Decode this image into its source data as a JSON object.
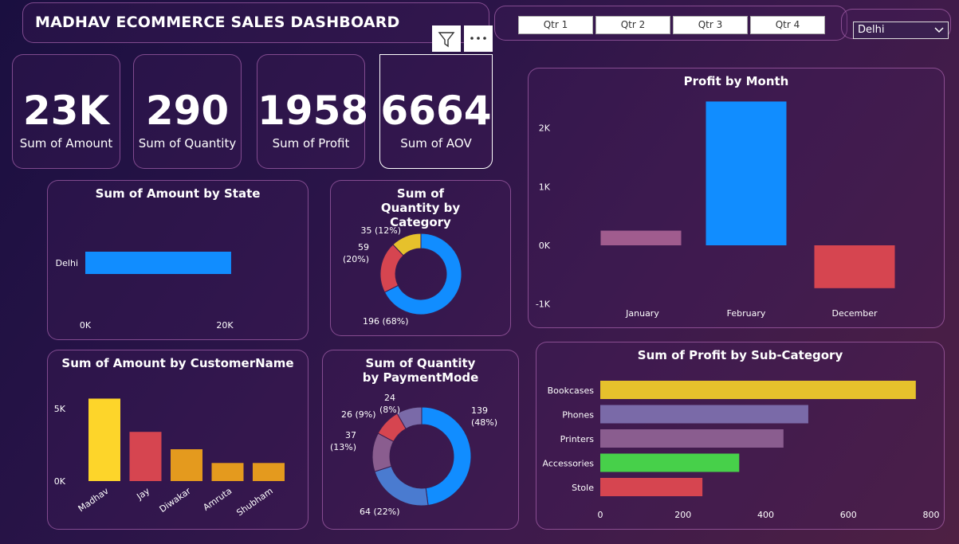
{
  "header": {
    "title": "MADHAV ECOMMERCE SALES DASHBOARD"
  },
  "slicer": {
    "quarters": [
      "Qtr 1",
      "Qtr 2",
      "Qtr 3",
      "Qtr 4"
    ],
    "state_selected": "Delhi"
  },
  "kpis": [
    {
      "value": "23K",
      "label": "Sum of Amount"
    },
    {
      "value": "290",
      "label": "Sum of Quantity"
    },
    {
      "value": "1958",
      "label": "Sum of Profit"
    },
    {
      "value": "6664",
      "label": "Sum of AOV"
    }
  ],
  "chart_data": [
    {
      "id": "amount_by_state",
      "type": "bar",
      "orientation": "horizontal",
      "title": "Sum of Amount by State",
      "categories": [
        "Delhi"
      ],
      "values": [
        23000
      ],
      "xlim": [
        0,
        22000
      ],
      "xticks": [
        "0K",
        "20K"
      ],
      "color": "#118dff"
    },
    {
      "id": "qty_by_category",
      "type": "pie",
      "donut": true,
      "title": "Sum of Quantity by Category",
      "values": [
        196,
        59,
        35
      ],
      "labels": [
        "196 (68%)",
        "59 (20%)",
        "35 (12%)"
      ],
      "colors": [
        "#118dff",
        "#d64550",
        "#e6c12c"
      ]
    },
    {
      "id": "amount_by_customer",
      "type": "bar",
      "title": "Sum of Amount by CustomerName",
      "categories": [
        "Madhav",
        "Jay",
        "Diwakar",
        "Amruta",
        "Shubham"
      ],
      "values": [
        5700,
        3400,
        2200,
        1250,
        1250
      ],
      "ylim": [
        0,
        6000
      ],
      "yticks": [
        "0K",
        "5K"
      ],
      "colors": [
        "#fdd52a",
        "#d64550",
        "#e49a1e",
        "#e49a1e",
        "#e49a1e"
      ]
    },
    {
      "id": "qty_by_payment",
      "type": "pie",
      "donut": true,
      "title": "Sum of Quantity by PaymentMode",
      "values": [
        139,
        64,
        37,
        26,
        24
      ],
      "labels": [
        "139 (48%)",
        "64 (22%)",
        "37 (13%)",
        "26 (9%)",
        "24 (8%)"
      ],
      "colors": [
        "#118dff",
        "#4a7bd0",
        "#8a5d8f",
        "#d64550",
        "#7a6aa8"
      ]
    },
    {
      "id": "profit_by_month",
      "type": "bar",
      "title": "Profit by Month",
      "categories": [
        "January",
        "February",
        "December"
      ],
      "values": [
        250,
        2450,
        -730
      ],
      "ylim": [
        -1000,
        2500
      ],
      "yticks": [
        "2K",
        "1K",
        "0K",
        "-1K"
      ],
      "colors": [
        "#a05c8e",
        "#118dff",
        "#d64550"
      ]
    },
    {
      "id": "profit_by_subcategory",
      "type": "bar",
      "orientation": "horizontal",
      "title": "Sum of Profit by Sub-Category",
      "categories": [
        "Bookcases",
        "Phones",
        "Printers",
        "Accessories",
        "Stole"
      ],
      "values": [
        763,
        503,
        443,
        336,
        247
      ],
      "xlim": [
        0,
        800
      ],
      "xticks": [
        "0",
        "200",
        "400",
        "600",
        "800"
      ],
      "colors": [
        "#e6c12c",
        "#7a6aa8",
        "#8a5d8f",
        "#47d04a",
        "#d64550"
      ]
    }
  ]
}
